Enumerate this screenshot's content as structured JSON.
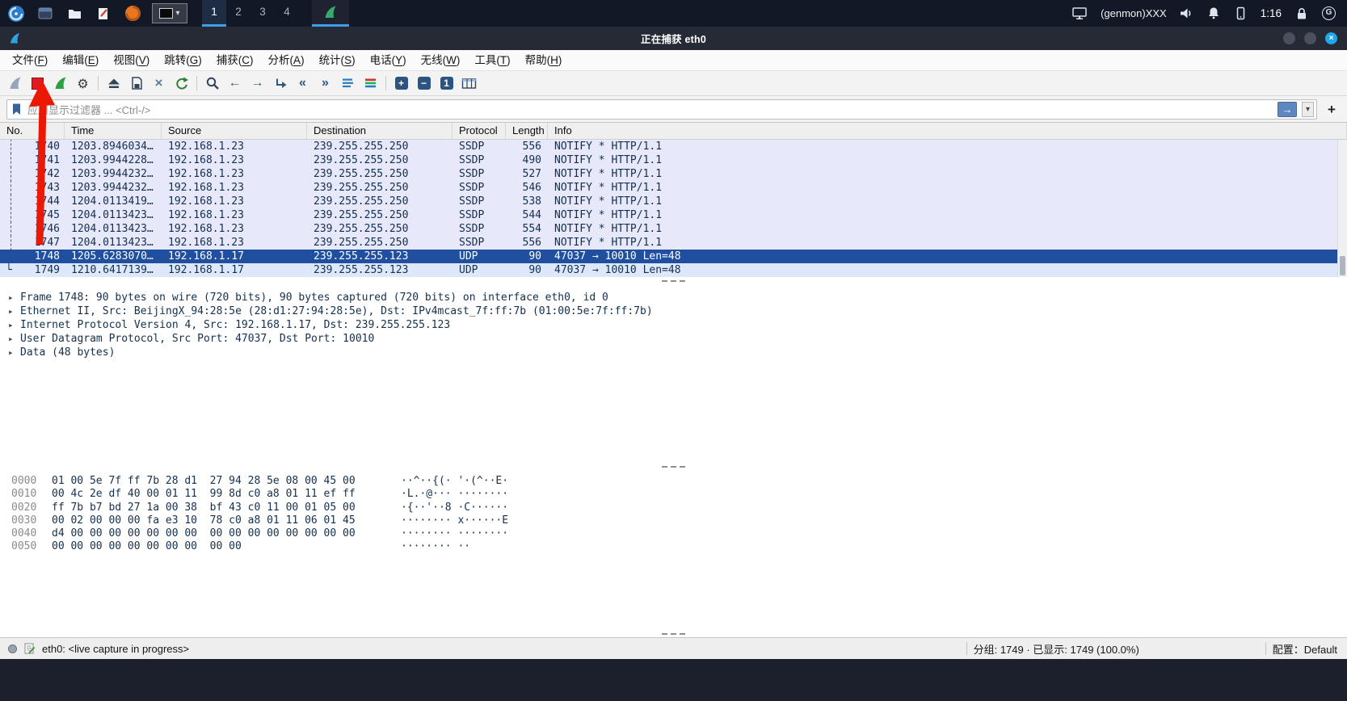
{
  "taskbar": {
    "workspaces": [
      "1",
      "2",
      "3",
      "4"
    ],
    "active_workspace": "1",
    "tray_label": "(genmon)XXX",
    "clock": "1:16"
  },
  "window": {
    "title": "正在捕获 eth0"
  },
  "menu": {
    "items": [
      {
        "label": "文件",
        "key": "F"
      },
      {
        "label": "编辑",
        "key": "E"
      },
      {
        "label": "视图",
        "key": "V"
      },
      {
        "label": "跳转",
        "key": "G"
      },
      {
        "label": "捕获",
        "key": "C"
      },
      {
        "label": "分析",
        "key": "A"
      },
      {
        "label": "统计",
        "key": "S"
      },
      {
        "label": "电话",
        "key": "Y"
      },
      {
        "label": "无线",
        "key": "W"
      },
      {
        "label": "工具",
        "key": "T"
      },
      {
        "label": "帮助",
        "key": "H"
      }
    ]
  },
  "icons": {
    "gear": "⚙",
    "close_x": "×",
    "window_close": "×",
    "prev": "←",
    "next": "→",
    "first": "«",
    "last": "»",
    "zoom_in": "+",
    "zoom_out": "−",
    "zoom_100": "1",
    "caret": "▾",
    "apply": "→",
    "add": "+",
    "globe": "G",
    "collapsed": "▸",
    "tree_corner": "└"
  },
  "filter": {
    "placeholder": "应用显示过滤器 ... <Ctrl-/>"
  },
  "packet_list": {
    "columns": [
      "No.",
      "Time",
      "Source",
      "Destination",
      "Protocol",
      "Length",
      "Info"
    ],
    "selected_no": "1748",
    "rows": [
      {
        "no": "1740",
        "time": "1203.8946034…",
        "source": "192.168.1.23",
        "destination": "239.255.255.250",
        "protocol": "SSDP",
        "length": "556",
        "info": "NOTIFY * HTTP/1.1",
        "tree": "dash"
      },
      {
        "no": "1741",
        "time": "1203.9944228…",
        "source": "192.168.1.23",
        "destination": "239.255.255.250",
        "protocol": "SSDP",
        "length": "490",
        "info": "NOTIFY * HTTP/1.1",
        "tree": "dash"
      },
      {
        "no": "1742",
        "time": "1203.9944232…",
        "source": "192.168.1.23",
        "destination": "239.255.255.250",
        "protocol": "SSDP",
        "length": "527",
        "info": "NOTIFY * HTTP/1.1",
        "tree": "dash"
      },
      {
        "no": "1743",
        "time": "1203.9944232…",
        "source": "192.168.1.23",
        "destination": "239.255.255.250",
        "protocol": "SSDP",
        "length": "546",
        "info": "NOTIFY * HTTP/1.1",
        "tree": "dash"
      },
      {
        "no": "1744",
        "time": "1204.0113419…",
        "source": "192.168.1.23",
        "destination": "239.255.255.250",
        "protocol": "SSDP",
        "length": "538",
        "info": "NOTIFY * HTTP/1.1",
        "tree": "dash"
      },
      {
        "no": "1745",
        "time": "1204.0113423…",
        "source": "192.168.1.23",
        "destination": "239.255.255.250",
        "protocol": "SSDP",
        "length": "544",
        "info": "NOTIFY * HTTP/1.1",
        "tree": "dash"
      },
      {
        "no": "1746",
        "time": "1204.0113423…",
        "source": "192.168.1.23",
        "destination": "239.255.255.250",
        "protocol": "SSDP",
        "length": "554",
        "info": "NOTIFY * HTTP/1.1",
        "tree": "dash"
      },
      {
        "no": "1747",
        "time": "1204.0113423…",
        "source": "192.168.1.23",
        "destination": "239.255.255.250",
        "protocol": "SSDP",
        "length": "556",
        "info": "NOTIFY * HTTP/1.1",
        "tree": "dash"
      },
      {
        "no": "1748",
        "time": "1205.6283070…",
        "source": "192.168.1.17",
        "destination": "239.255.255.123",
        "protocol": "UDP",
        "length": "90",
        "info": "47037 → 10010 Len=48",
        "tree": "none"
      },
      {
        "no": "1749",
        "time": "1210.6417139…",
        "source": "192.168.1.17",
        "destination": "239.255.255.123",
        "protocol": "UDP",
        "length": "90",
        "info": "47037 → 10010 Len=48",
        "tree": "corner"
      }
    ]
  },
  "detail": {
    "lines": [
      "Frame 1748: 90 bytes on wire (720 bits), 90 bytes captured (720 bits) on interface eth0, id 0",
      "Ethernet II, Src: BeijingX_94:28:5e (28:d1:27:94:28:5e), Dst: IPv4mcast_7f:ff:7b (01:00:5e:7f:ff:7b)",
      "Internet Protocol Version 4, Src: 192.168.1.17, Dst: 239.255.255.123",
      "User Datagram Protocol, Src Port: 47037, Dst Port: 10010",
      "Data (48 bytes)"
    ]
  },
  "hex_dump": {
    "rows": [
      {
        "offset": "0000",
        "bytes": "01 00 5e 7f ff 7b 28 d1  27 94 28 5e 08 00 45 00",
        "ascii": "··^··{(· '·(^··E·"
      },
      {
        "offset": "0010",
        "bytes": "00 4c 2e df 40 00 01 11  99 8d c0 a8 01 11 ef ff",
        "ascii": "·L.·@··· ········"
      },
      {
        "offset": "0020",
        "bytes": "ff 7b b7 bd 27 1a 00 38  bf 43 c0 11 00 01 05 00",
        "ascii": "·{··'··8 ·C······"
      },
      {
        "offset": "0030",
        "bytes": "00 02 00 00 00 fa e3 10  78 c0 a8 01 11 06 01 45",
        "ascii": "········ x······E"
      },
      {
        "offset": "0040",
        "bytes": "d4 00 00 00 00 00 00 00  00 00 00 00 00 00 00 00",
        "ascii": "········ ········"
      },
      {
        "offset": "0050",
        "bytes": "00 00 00 00 00 00 00 00  00 00",
        "ascii": "········ ··"
      }
    ]
  },
  "status": {
    "left": "eth0: <live capture in progress>",
    "packets": "分组: 1749 · 已显示: 1749 (100.0%)",
    "profile": "配置：Default"
  },
  "colors": {
    "selection": "#1f4f9e",
    "ssdp_row": "#e7e8fa",
    "udp_row": "#dde9fa",
    "annotation_arrow": "#eb1806",
    "taskbar_accent": "#3f9ee8"
  }
}
